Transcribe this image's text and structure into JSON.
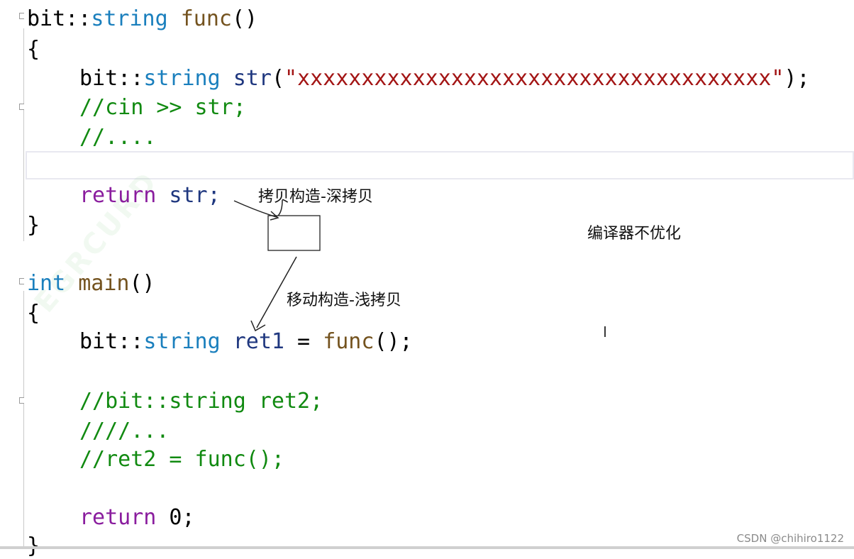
{
  "code": {
    "func_decl": {
      "type_ns": "bit::",
      "type": "string",
      "name": "func",
      "parens": "()"
    },
    "open1": "{",
    "str_decl": {
      "type_ns": "bit::",
      "type": "string",
      "var": "str",
      "lparen": "(",
      "literal": "\"xxxxxxxxxxxxxxxxxxxxxxxxxxxxxxxxxxxxx\"",
      "rparen": ");"
    },
    "comment_cin": "//cin >> str;",
    "comment_dots": "//....",
    "return_str": {
      "kw": "return",
      "rest": " str;"
    },
    "close1": "}",
    "main_decl": {
      "kw": "int",
      "name": "main",
      "parens": "()"
    },
    "open2": "{",
    "ret1_decl": {
      "type_ns": "bit::",
      "type": "string",
      "var": "ret1",
      "eq": " = ",
      "fn": "func",
      "call": "();"
    },
    "comment_ret2_decl": "//bit::string ret2;",
    "comment_ret2_dots": "////...",
    "comment_ret2_assign": "//ret2 = func();",
    "return_zero": {
      "kw": "return",
      "rest": " 0;"
    },
    "close2": "}"
  },
  "annotations": {
    "copy_deep": "拷贝构造-深拷贝",
    "move_shallow": "移动构造-浅拷贝",
    "no_optimize": "编译器不优化"
  },
  "watermark": "EGRCURD",
  "credit": "CSDN @chihiro1122",
  "cursor_glyph": "I"
}
